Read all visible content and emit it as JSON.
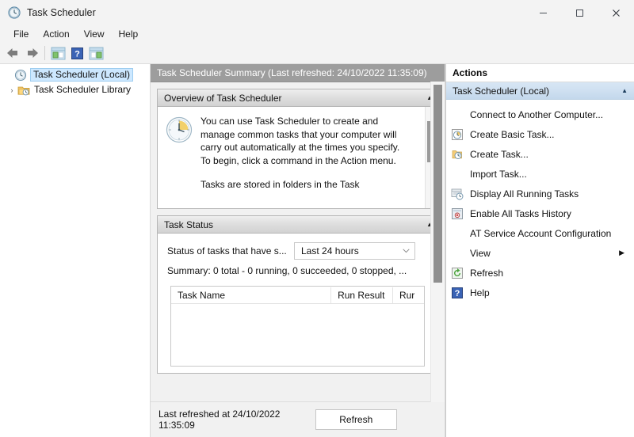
{
  "window": {
    "title": "Task Scheduler",
    "icon": "clock-icon",
    "minimize_label": "Minimize",
    "maximize_label": "Maximize",
    "close_label": "Close"
  },
  "menubar": {
    "items": [
      {
        "label": "File"
      },
      {
        "label": "Action"
      },
      {
        "label": "View"
      },
      {
        "label": "Help"
      }
    ]
  },
  "toolbar": {
    "items": [
      {
        "name": "back-arrow-icon",
        "label": "Back"
      },
      {
        "name": "forward-arrow-icon",
        "label": "Forward"
      },
      {
        "name": "show-hide-console-tree-icon",
        "label": "Show/Hide Console Tree"
      },
      {
        "name": "help-icon",
        "label": "Help"
      },
      {
        "name": "show-hide-action-pane-icon",
        "label": "Show/Hide Action Pane"
      }
    ]
  },
  "tree": {
    "items": [
      {
        "label": "Task Scheduler (Local)",
        "icon": "clock-icon",
        "selected": true,
        "expandable": false
      },
      {
        "label": "Task Scheduler Library",
        "icon": "folder-clock-icon",
        "selected": false,
        "expandable": true,
        "expander": "›"
      }
    ]
  },
  "summary": {
    "header": "Task Scheduler Summary (Last refreshed: 24/10/2022 11:35:09)",
    "overview": {
      "title": "Overview of Task Scheduler",
      "collapse_glyph": "▲",
      "paragraph1": "You can use Task Scheduler to create and manage common tasks that your computer will carry out automatically at the times you specify. To begin, click a command in the Action menu.",
      "paragraph2": "Tasks are stored in folders in the Task"
    },
    "task_status": {
      "title": "Task Status",
      "collapse_glyph": "▲",
      "status_label": "Status of tasks that have s...",
      "period_value": "Last 24 hours",
      "period_caret": "⌄",
      "summary_line": "Summary: 0 total - 0 running, 0 succeeded, 0 stopped, ...",
      "columns": [
        {
          "label": "Task Name"
        },
        {
          "label": "Run Result"
        },
        {
          "label": "Rur"
        }
      ],
      "rows": []
    },
    "footer": {
      "last_refreshed": "Last refreshed at 24/10/2022 11:35:09",
      "refresh_button": "Refresh"
    }
  },
  "actions": {
    "header": "Actions",
    "group_title": "Task Scheduler (Local)",
    "group_collapse_glyph": "▲",
    "items": [
      {
        "label": "Connect to Another Computer...",
        "icon": "none",
        "submenu": false
      },
      {
        "label": "Create Basic Task...",
        "icon": "create-basic-task-icon",
        "submenu": false
      },
      {
        "label": "Create Task...",
        "icon": "create-task-icon",
        "submenu": false
      },
      {
        "label": "Import Task...",
        "icon": "none",
        "submenu": false
      },
      {
        "label": "Display All Running Tasks",
        "icon": "display-running-tasks-icon",
        "submenu": false
      },
      {
        "label": "Enable All Tasks History",
        "icon": "enable-history-icon",
        "submenu": false
      },
      {
        "label": "AT Service Account Configuration",
        "icon": "none",
        "submenu": false
      },
      {
        "label": "View",
        "icon": "none",
        "submenu": true,
        "submenu_glyph": "▶"
      },
      {
        "label": "Refresh",
        "icon": "refresh-icon",
        "submenu": false
      },
      {
        "label": "Help",
        "icon": "help-icon",
        "submenu": false
      }
    ]
  },
  "colors": {
    "titlebar_bg": "#f3f3f3",
    "summary_header_bg": "#9d9d9d",
    "actions_group_bg": "#cfe0f1",
    "tree_selection_bg": "#cde8ff",
    "scrollbar_thumb": "#8f8f8f"
  }
}
